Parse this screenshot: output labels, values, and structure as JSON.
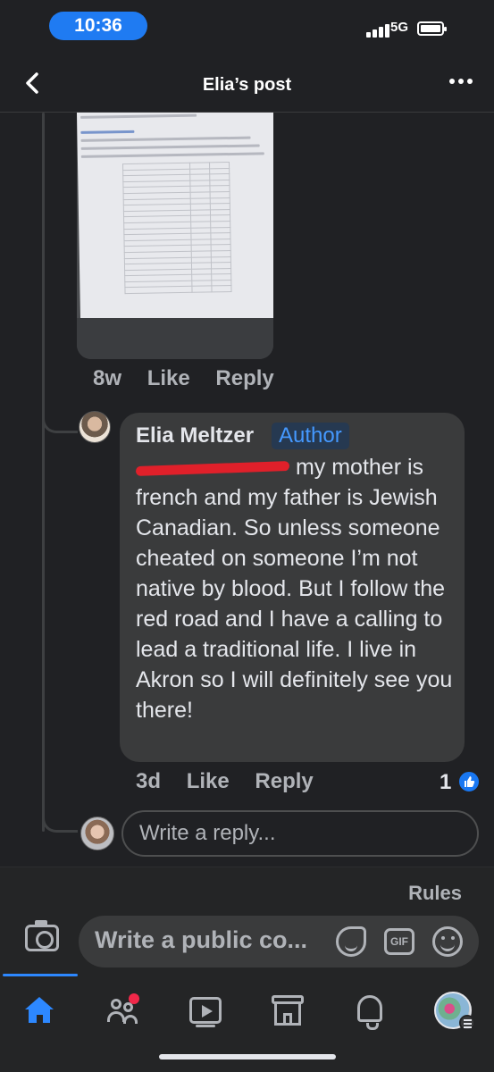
{
  "status_bar": {
    "time": "10:36",
    "network": "5G"
  },
  "header": {
    "title": "Elia’s post"
  },
  "attachment_comment": {
    "age": "8w",
    "like_label": "Like",
    "reply_label": "Reply"
  },
  "comment": {
    "author": "Elia Meltzer",
    "badge": "Author",
    "text_after_mention": " my mother is french and my father is Jewish Canadian. So unless someone cheated on someone I’m not native by blood. But I follow the red road and I have a calling to lead a traditional life. I live in Akron so I will definitely see you there!",
    "age": "3d",
    "like_label": "Like",
    "reply_label": "Reply",
    "reaction_count": "1"
  },
  "reply_box": {
    "placeholder": "Write a reply..."
  },
  "composer": {
    "rules_label": "Rules",
    "placeholder": "Write a public co...",
    "gif_label": "GIF"
  },
  "colors": {
    "accent": "#1877f2",
    "redaction": "#e0202a",
    "background": "#202124"
  }
}
